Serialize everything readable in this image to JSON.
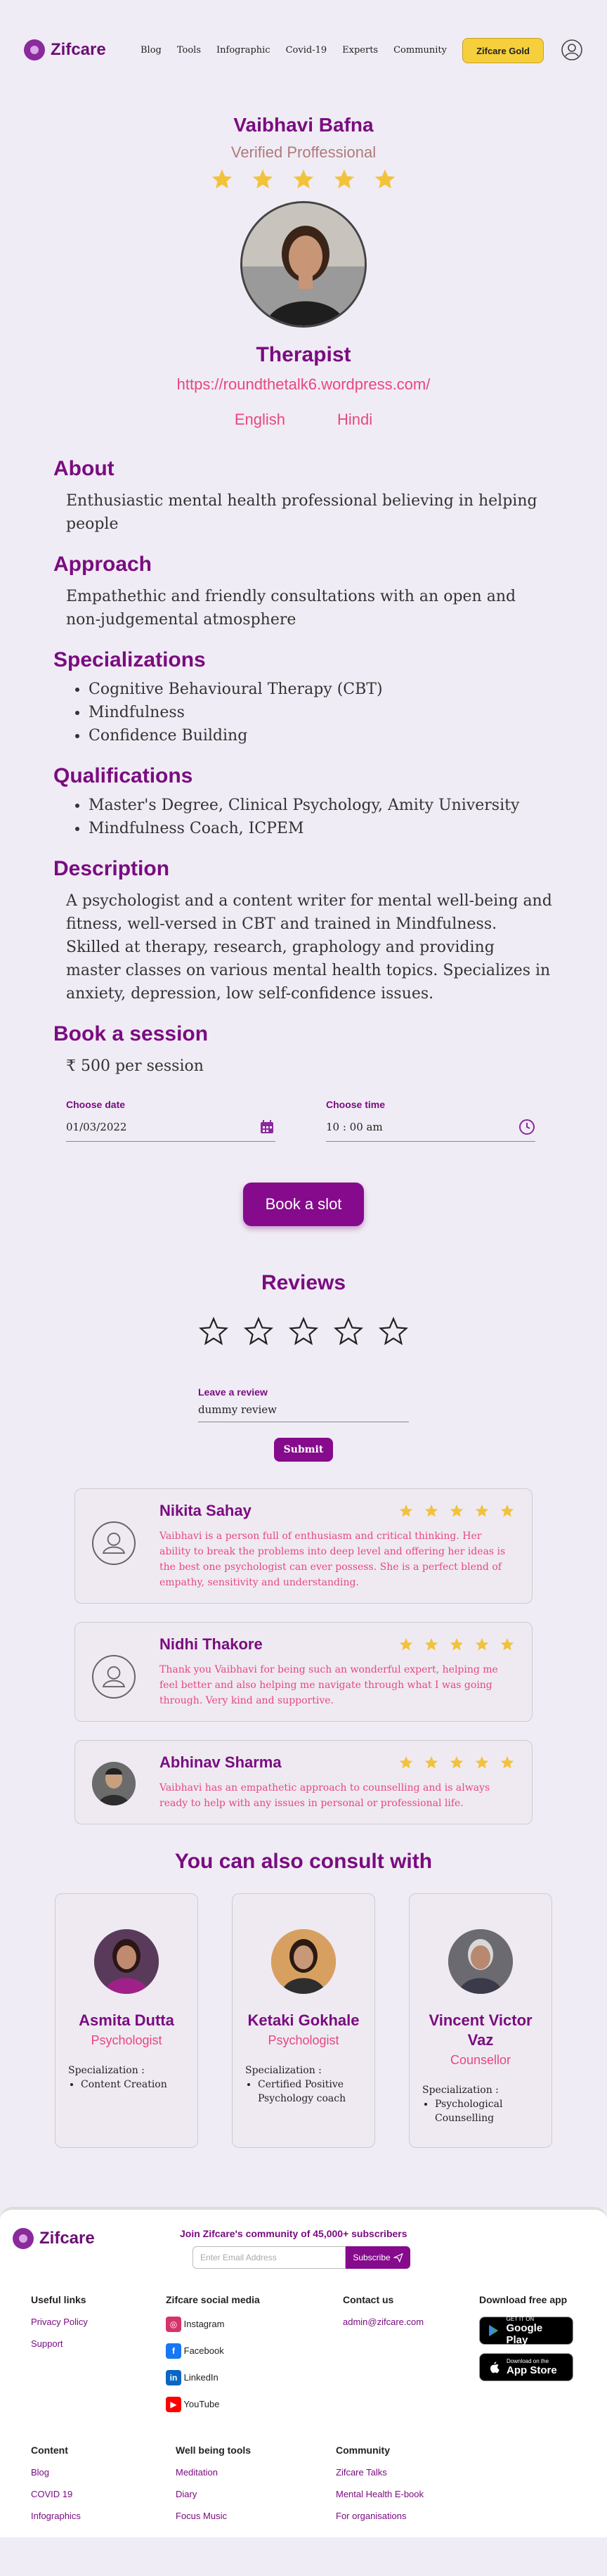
{
  "nav": {
    "brand": "Zifcare",
    "links": [
      "Blog",
      "Tools",
      "Infographic",
      "Covid-19",
      "Experts",
      "Community"
    ],
    "gold_label": "Zifcare Gold"
  },
  "profile": {
    "name": "Vaibhavi Bafna",
    "verified": "Verified Proffessional",
    "rating": 5,
    "role": "Therapist",
    "url": "https://roundthetalk6.wordpress.com/",
    "languages": [
      "English",
      "Hindi"
    ]
  },
  "about": {
    "title": "About",
    "text": "Enthusiastic mental health professional believing in helping people"
  },
  "approach": {
    "title": "Approach",
    "text": "Empathethic and friendly consultations with an open and non-judgemental atmosphere"
  },
  "specializations": {
    "title": "Specializations",
    "items": [
      "Cognitive Behavioural Therapy (CBT)",
      "Mindfulness",
      "Confidence Building"
    ]
  },
  "qualifications": {
    "title": "Qualifications",
    "items": [
      "Master's Degree, Clinical Psychology, Amity University",
      "Mindfulness Coach, ICPEM"
    ]
  },
  "description": {
    "title": "Description",
    "text": "A psychologist and a content writer for mental well-being and fitness, well-versed in CBT and trained in Mindfulness. Skilled at therapy, research, graphology and providing master classes on various mental health topics. Specializes in anxiety, depression, low self-confidence issues."
  },
  "booking": {
    "title": "Book a session",
    "price": "₹ 500 per session",
    "date_label": "Choose date",
    "date_value": "01/03/2022",
    "time_label": "Choose time",
    "time_value": "10 : 00 am",
    "button": "Book a slot"
  },
  "reviews": {
    "title": "Reviews",
    "leave_label": "Leave a review",
    "input_value": "dummy review",
    "submit": "Submit",
    "items": [
      {
        "name": "Nikita Sahay",
        "rating": 5,
        "text": "Vaibhavi is a person full of enthusiasm and critical thinking. Her ability to break the problems into deep level and offering her ideas is the best one psychologist can ever possess. She is a perfect blend of empathy, sensitivity and understanding."
      },
      {
        "name": "Nidhi Thakore",
        "rating": 5,
        "text": "Thank you Vaibhavi for being such an wonderful expert, helping me feel better and also helping me navigate through what I was going through. Very kind and supportive."
      },
      {
        "name": "Abhinav Sharma",
        "rating": 5,
        "text": "Vaibhavi has an empathetic approach to counselling and is always ready to help with any issues in personal or professional life."
      }
    ]
  },
  "consult": {
    "title": "You can also consult with",
    "spec_label": "Specialization :",
    "experts": [
      {
        "name": "Asmita Dutta",
        "role": "Psychologist",
        "specs": [
          "Content Creation"
        ]
      },
      {
        "name": "Ketaki Gokhale",
        "role": "Psychologist",
        "specs": [
          "Certified Positive Psychology coach"
        ]
      },
      {
        "name": "Vincent Victor Vaz",
        "role": "Counsellor",
        "specs": [
          "Psychological Counselling"
        ]
      }
    ]
  },
  "footer": {
    "brand": "Zifcare",
    "join": "Join Zifcare's community of 45,000+ subscribers",
    "email_placeholder": "Enter Email Address",
    "subscribe": "Subscribe",
    "useful_title": "Useful links",
    "useful": [
      "Privacy Policy",
      "Support"
    ],
    "social_title": "Zifcare social media",
    "social": [
      "Instagram",
      "Facebook",
      "LinkedIn",
      "YouTube"
    ],
    "contact_title": "Contact us",
    "contact_email": "admin@zifcare.com",
    "download_title": "Download free app",
    "google_small": "GET IT ON",
    "google": "Google Play",
    "apple_small": "Download on the",
    "apple": "App Store",
    "content_title": "Content",
    "content": [
      "Blog",
      "COVID 19",
      "Infographics"
    ],
    "tools_title": "Well being tools",
    "tools": [
      "Meditation",
      "Diary",
      "Focus Music"
    ],
    "community_title": "Community",
    "community": [
      "Zifcare Talks",
      "Mental Health E-book",
      "For organisations"
    ]
  }
}
